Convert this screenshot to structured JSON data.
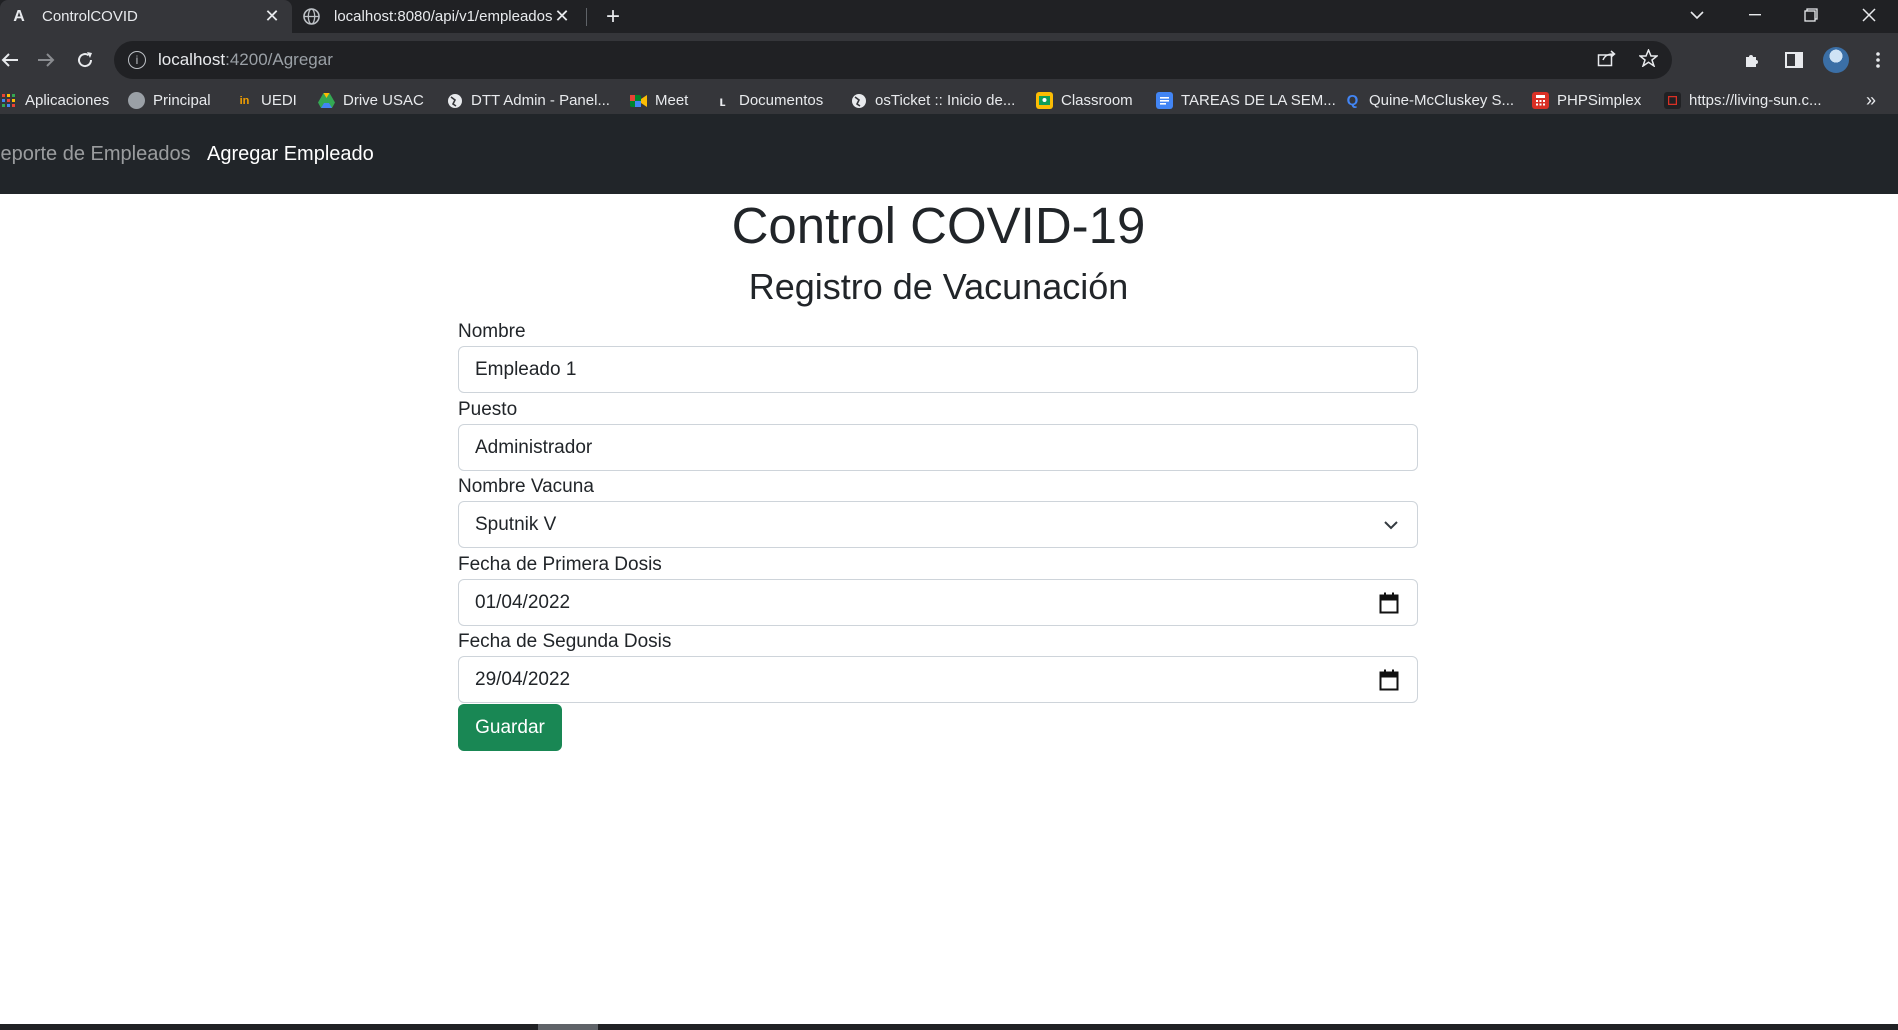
{
  "browser": {
    "tabs": [
      {
        "title": "ControlCOVID",
        "favicon": "A"
      },
      {
        "title": "localhost:8080/api/v1/empleados",
        "favicon": "globe-icon"
      }
    ],
    "close_glyph": "✕",
    "new_tab_glyph": "+",
    "url_host": "localhost",
    "url_path": ":4200/Agregar",
    "bookmarks": [
      {
        "label": "Aplicaciones",
        "icon": "apps-grid-icon",
        "color": "#ea4335"
      },
      {
        "label": "Principal",
        "icon": "globe-icon",
        "color": "#9aa0a6"
      },
      {
        "label": "UEDI",
        "icon": "uedi-icon",
        "color": "#f4a000"
      },
      {
        "label": "Drive USAC",
        "icon": "drive-icon",
        "color": "#34a853"
      },
      {
        "label": "DTT Admin - Panel...",
        "icon": "globe-icon",
        "color": "#e8eaed"
      },
      {
        "label": "Meet",
        "icon": "meet-icon",
        "color": "#00832d"
      },
      {
        "label": "Documentos",
        "icon": "docs-icon",
        "color": "#e8eaed"
      },
      {
        "label": "osTicket :: Inicio de...",
        "icon": "globe-icon",
        "color": "#e8eaed"
      },
      {
        "label": "Classroom",
        "icon": "classroom-icon",
        "color": "#fbbc04"
      },
      {
        "label": "TAREAS DE LA SEM...",
        "icon": "docs-blue-icon",
        "color": "#4285f4"
      },
      {
        "label": "Quine-McCluskey S...",
        "icon": "q-icon",
        "color": "#4285f4"
      },
      {
        "label": "PHPSimplex",
        "icon": "calculator-icon",
        "color": "#d93025"
      },
      {
        "label": "https://living-sun.c...",
        "icon": "site-icon",
        "color": "#d93025"
      }
    ],
    "bookmarks_more": "»"
  },
  "navbar": {
    "links": [
      {
        "label": "Reporte de Empleados",
        "active": false
      },
      {
        "label": "Agregar Empleado",
        "active": true
      }
    ]
  },
  "page": {
    "title": "Control COVID-19",
    "subtitle": "Registro de Vacunación"
  },
  "form": {
    "nombre": {
      "label": "Nombre",
      "value": "Empleado 1"
    },
    "puesto": {
      "label": "Puesto",
      "value": "Administrador"
    },
    "vacuna": {
      "label": "Nombre Vacuna",
      "value": "Sputnik V"
    },
    "primera_dosis": {
      "label": "Fecha de Primera Dosis",
      "value": "01/04/2022"
    },
    "segunda_dosis": {
      "label": "Fecha de Segunda Dosis",
      "value": "29/04/2022"
    },
    "save_label": "Guardar"
  },
  "colors": {
    "navbar_bg": "#212529",
    "save_button": "#198754"
  }
}
